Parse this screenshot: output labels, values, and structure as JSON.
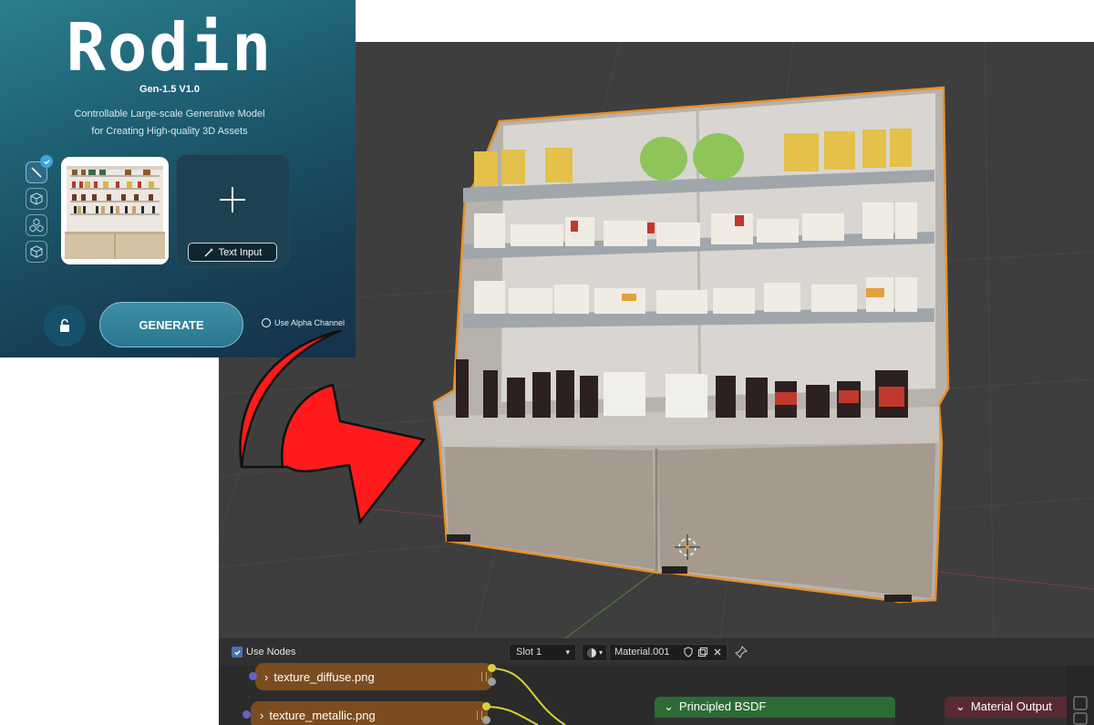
{
  "rodin": {
    "logo": "Rodin",
    "version": "Gen-1.5 V1.0",
    "tagline_1": "Controllable Large-scale Generative Model",
    "tagline_2": "for Creating High-quality 3D Assets",
    "text_input_label": "Text Input",
    "generate_label": "GENERATE",
    "alpha_label": "Use Alpha Channel"
  },
  "node_editor": {
    "use_nodes_label": "Use Nodes",
    "slot_label": "Slot 1",
    "material_name": "Material.001",
    "nodes": {
      "diffuse": "texture_diffuse.png",
      "metallic": "texture_metallic.png",
      "bsdf": "Principled BSDF",
      "output": "Material Output"
    }
  },
  "colors": {
    "accent_arrow": "#ff0000",
    "selection_outline": "#e8902b",
    "texture_node": "#7b4c1f",
    "bsdf_node": "#2d6b35",
    "output_node": "#5a2a33"
  }
}
